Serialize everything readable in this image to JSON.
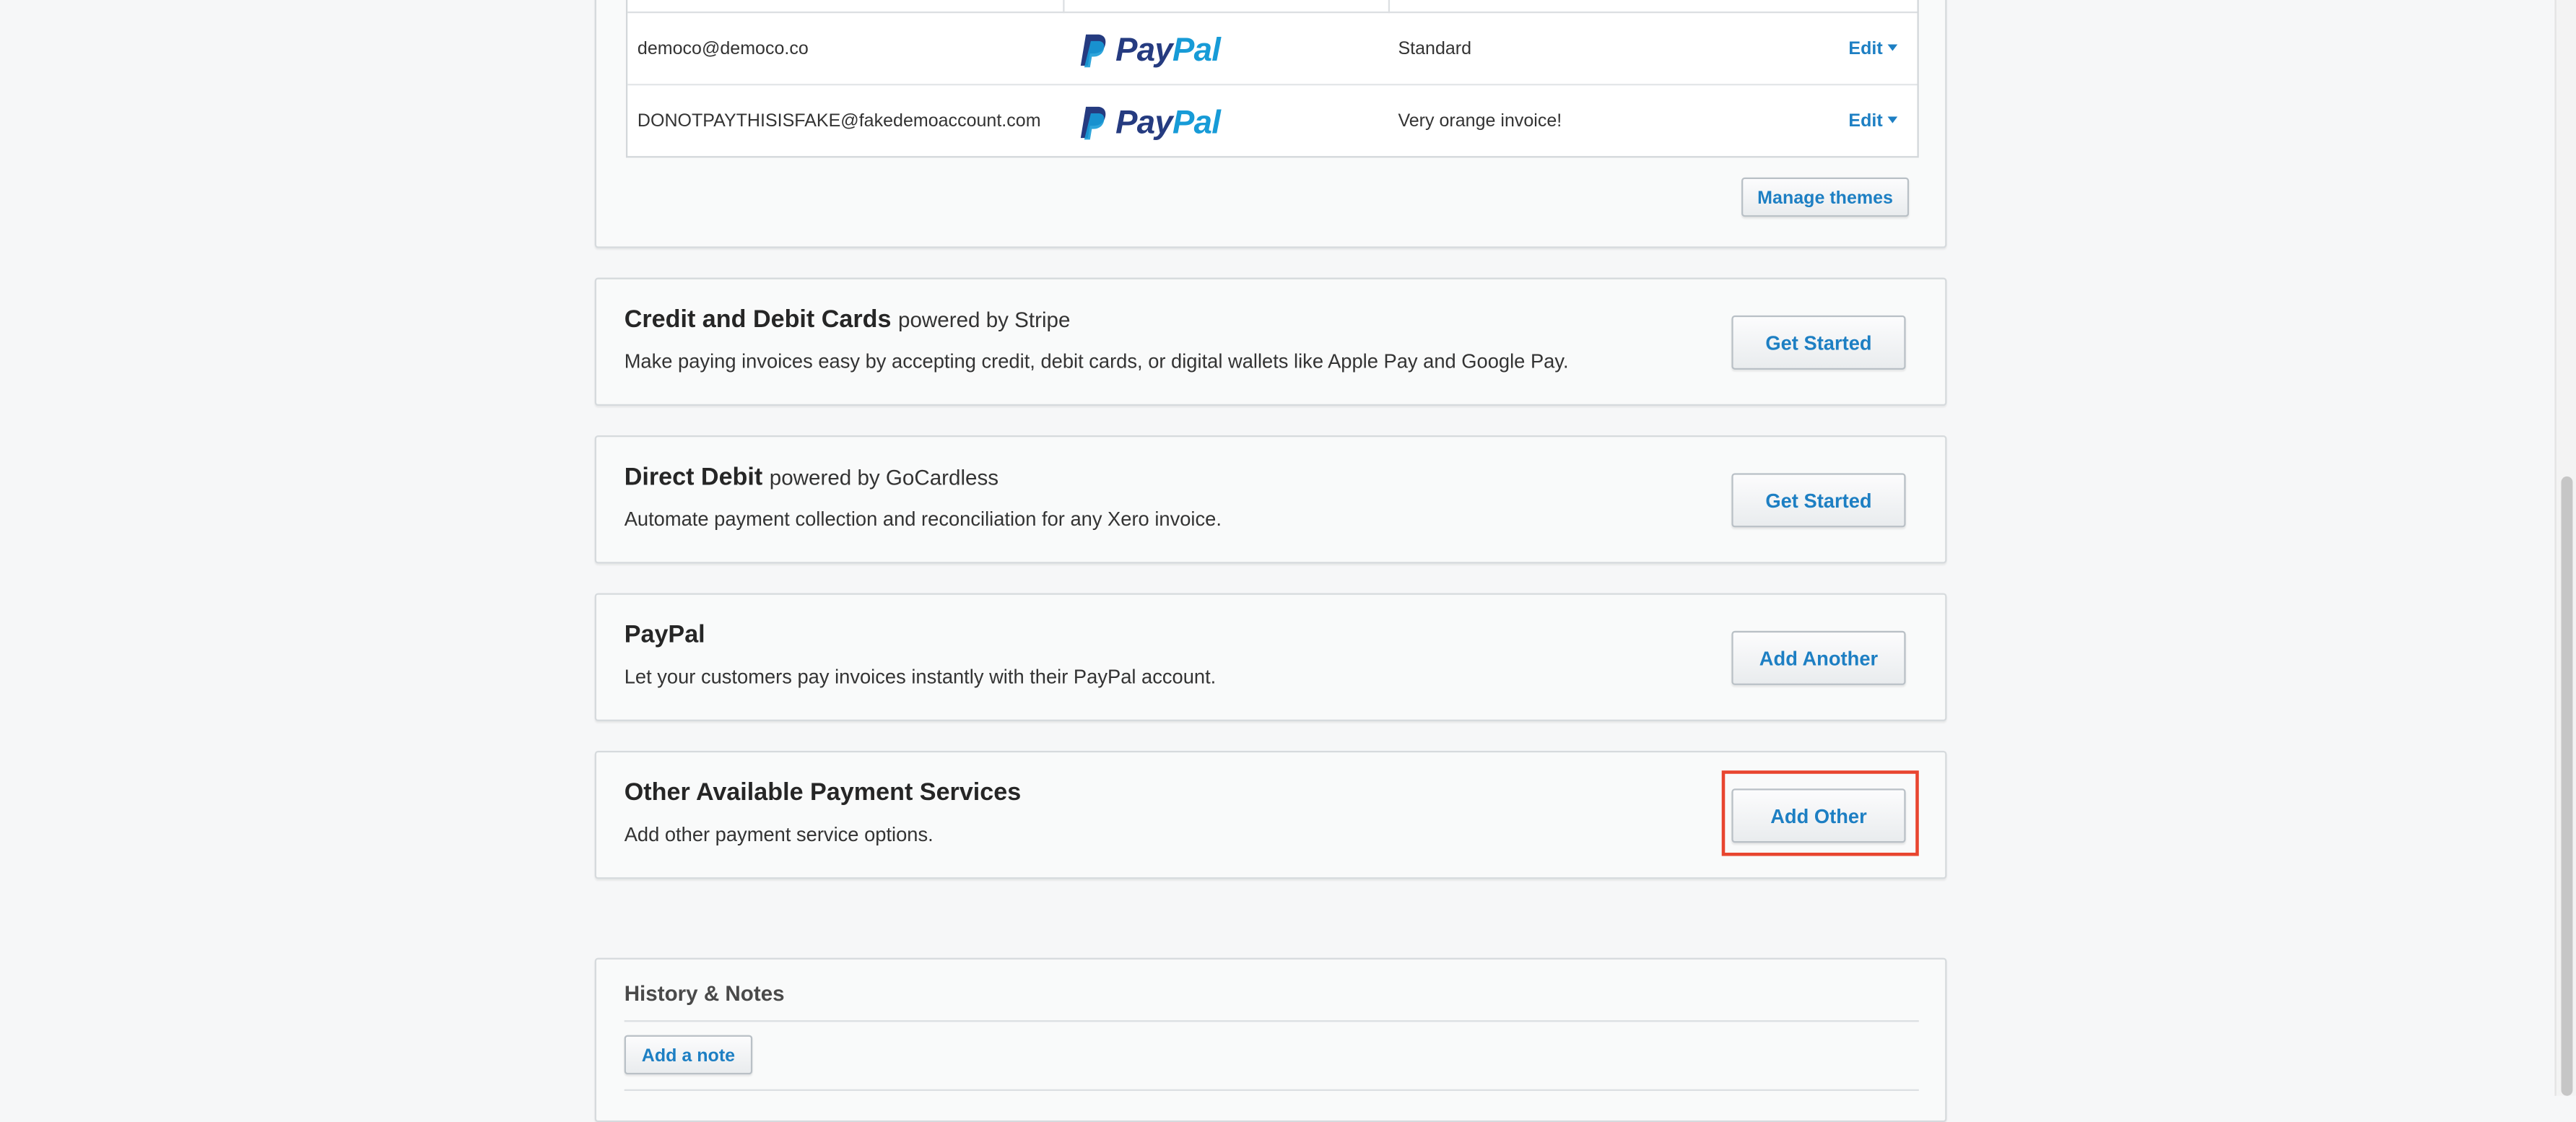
{
  "accounts": {
    "rows": [
      {
        "email": "democo@democo.co",
        "theme": "Standard",
        "edit_label": "Edit"
      },
      {
        "email": "DONOTPAYTHISISFAKE@fakedemoaccount.com",
        "theme": "Very orange invoice!",
        "edit_label": "Edit"
      }
    ],
    "logo_text": {
      "pay": "Pay",
      "pal": "Pal"
    },
    "manage_themes_label": "Manage themes"
  },
  "services": {
    "credit": {
      "title": "Credit and Debit Cards",
      "powered": "powered by Stripe",
      "description": "Make paying invoices easy by accepting credit, debit cards, or digital wallets like Apple Pay and Google Pay.",
      "button_label": "Get Started"
    },
    "debit": {
      "title": "Direct Debit",
      "powered": "powered by GoCardless",
      "description": "Automate payment collection and reconciliation for any Xero invoice.",
      "button_label": "Get Started"
    },
    "paypal": {
      "title": "PayPal",
      "description": "Let your customers pay invoices instantly with their PayPal account.",
      "button_label": "Add Another"
    },
    "other": {
      "title": "Other Available Payment Services",
      "description": "Add other payment service options.",
      "button_label": "Add Other"
    }
  },
  "history": {
    "title": "History & Notes",
    "add_note_label": "Add a note"
  },
  "colors": {
    "link_blue": "#1d7fc3",
    "highlight_red": "#e8452f",
    "paypal_dark": "#253b80",
    "paypal_light": "#179bd7"
  },
  "icons": {
    "paypal_logo": "paypal-logo-icon",
    "edit_caret": "caret-down-icon"
  }
}
